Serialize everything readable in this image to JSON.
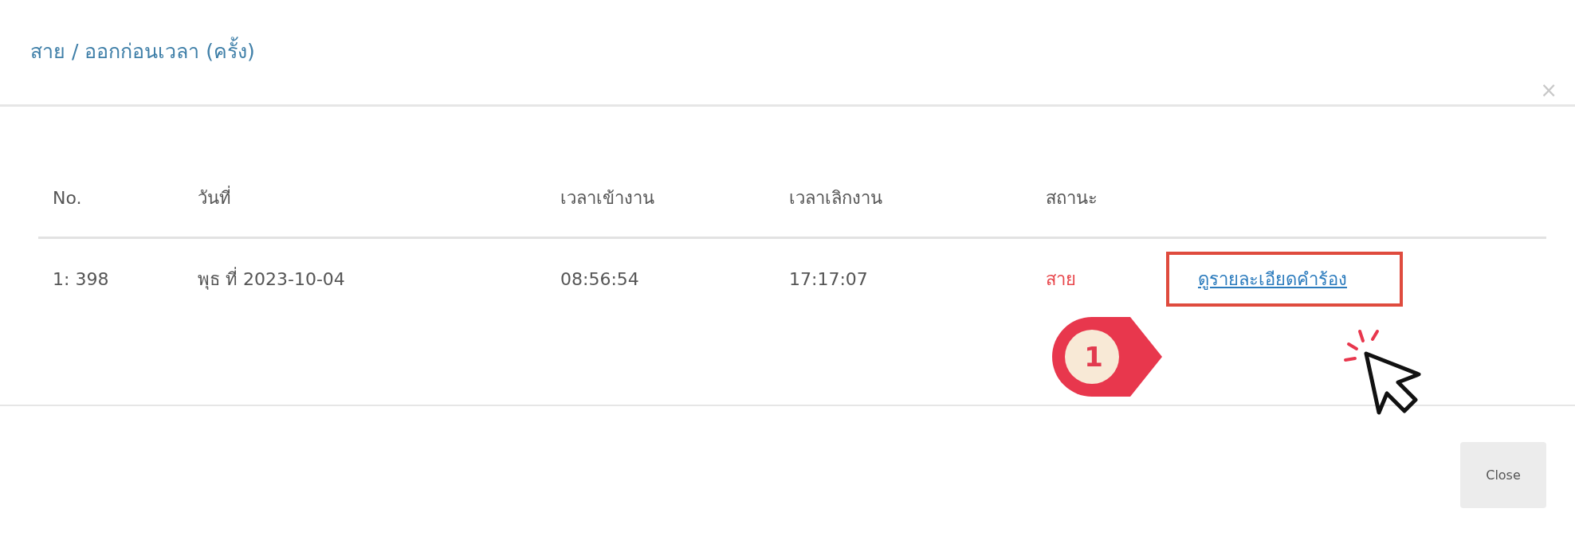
{
  "modal": {
    "title": "สาย / ออกก่อนเวลา (ครั้ง)",
    "close_icon": "×"
  },
  "table": {
    "columns": [
      "No.",
      "วันที่",
      "เวลาเข้างาน",
      "เวลาเลิกงาน",
      "สถานะ"
    ],
    "rows": [
      {
        "no": "1: 398",
        "date": "พุธ ที่ 2023-10-04",
        "time_in": "08:56:54",
        "time_out": "17:17:07",
        "status": "สาย",
        "color": "#e8464b",
        "link": "ดูรายละเอียดคำร้อง"
      }
    ]
  },
  "annotation": {
    "number": "1"
  },
  "footer": {
    "buttons": [
      "Close"
    ]
  }
}
